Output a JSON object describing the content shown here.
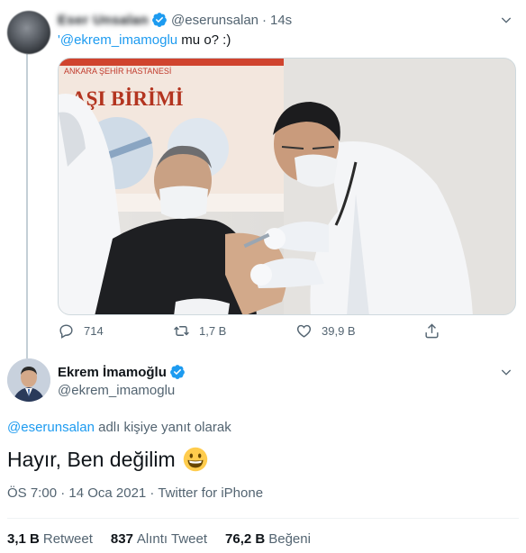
{
  "tweet1": {
    "display_name": "Eser Unsalan",
    "handle": "@eserunsalan",
    "separator": "·",
    "time": "14s",
    "text_mention": "'@ekrem_imamoglu",
    "text_rest": " mu o? :)",
    "image": {
      "sign_line1": "ANKARA ŞEHİR HASTANESİ",
      "sign_line2": "AŞI BİRİMİ"
    },
    "actions": {
      "replies": "714",
      "retweets": "1,7 B",
      "likes": "39,9 B"
    }
  },
  "tweet2": {
    "display_name": "Ekrem İmamoğlu",
    "handle": "@ekrem_imamoglu",
    "reply_mention": "@eserunsalan",
    "reply_suffix": " adlı kişiye yanıt olarak",
    "text": "Hayır, Ben değilim",
    "timestamp": "ÖS 7:00 · 14 Oca 2021 · ",
    "source": "Twitter for iPhone",
    "stats": {
      "retweets_count": "3,1 B",
      "retweets_label": "Retweet",
      "quotes_count": "837",
      "quotes_label": "Alıntı Tweet",
      "likes_count": "76,2 B",
      "likes_label": "Beğeni"
    }
  },
  "colors": {
    "accent": "#1d9bf0",
    "muted": "#536471",
    "text": "#0f1419"
  }
}
